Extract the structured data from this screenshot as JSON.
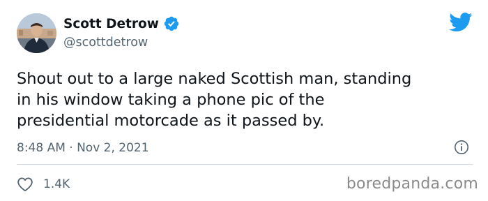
{
  "author": {
    "display_name": "Scott Detrow",
    "handle": "@scottdetrow"
  },
  "tweet": {
    "lines": [
      "Shout out to a large naked Scottish man, standing",
      "in his window taking a phone pic of the",
      "presidential motorcade as it passed by."
    ],
    "timestamp": "8:48 AM · Nov 2, 2021",
    "like_count": "1.4K"
  },
  "icons": {
    "verified": "verified-badge-icon",
    "platform": "twitter-bird-icon",
    "info": "info-icon",
    "like": "heart-icon"
  },
  "watermark": "boredpanda.com",
  "colors": {
    "text_primary": "#0f1419",
    "text_secondary": "#536471",
    "accent": "#1d9bf0",
    "divider": "#cfd9de",
    "watermark": "#8a8a8a"
  }
}
